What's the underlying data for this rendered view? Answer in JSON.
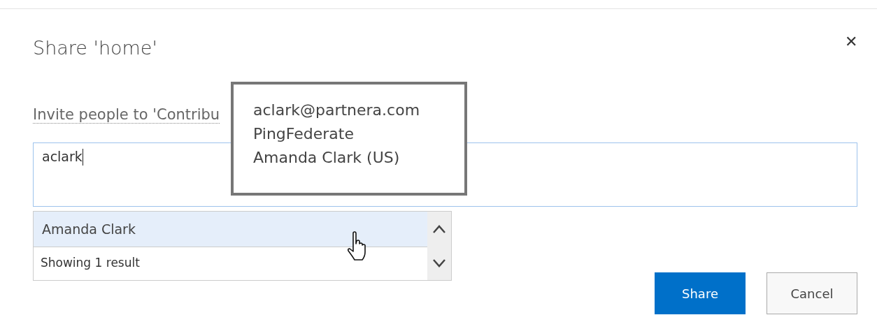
{
  "dialog": {
    "title": "Share 'home'",
    "close": "✕"
  },
  "invite": {
    "label": "Invite people to 'Contribu",
    "value": "aclark"
  },
  "tooltip": {
    "lines": [
      "aclark@partnera.com",
      "PingFederate",
      "Amanda Clark (US)"
    ]
  },
  "suggestions": [
    {
      "name": "Amanda Clark",
      "selected": true
    }
  ],
  "result_count": "Showing 1 result",
  "buttons": [
    {
      "label": "Share",
      "kind": "primary"
    },
    {
      "label": "Cancel",
      "kind": "secondary"
    }
  ]
}
